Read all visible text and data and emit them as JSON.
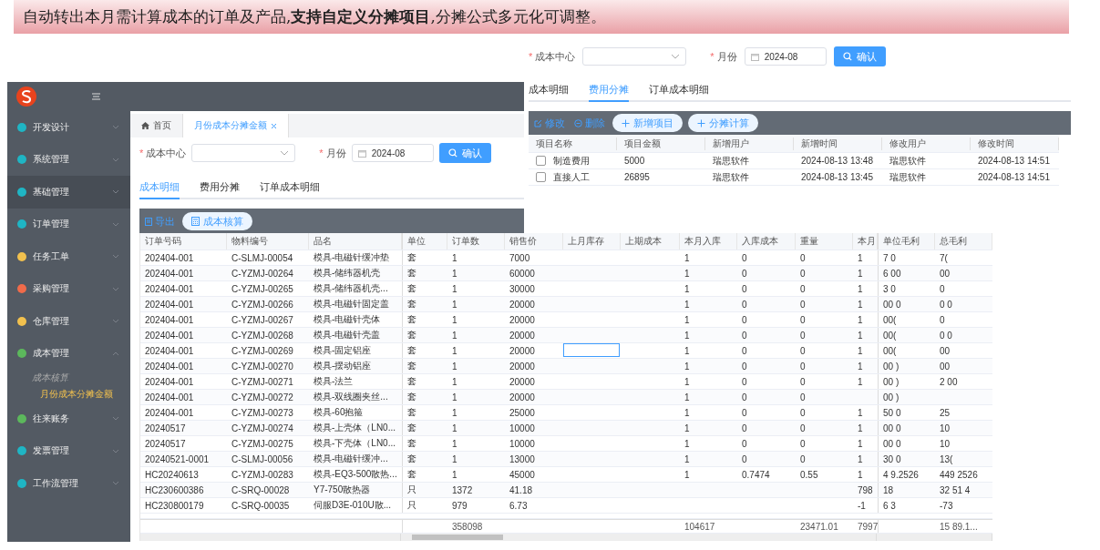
{
  "banner": {
    "text": "自动转出本月需计算成本的订单及产品,**支持自定义分摊项目**,分摊公式多元化可调整。"
  },
  "allocation_panel": {
    "form": {
      "required_mark": "*",
      "cost_center_label": "成本中心",
      "month_label": "月份",
      "month_value": "2024-08",
      "confirm": "确认"
    },
    "tabs": [
      {
        "label": "成本明细",
        "selected": false
      },
      {
        "label": "费用分摊",
        "selected": true
      },
      {
        "label": "订单成本明细",
        "selected": false
      }
    ],
    "toolbar": {
      "edit": "修改",
      "delete": "删除",
      "add": "新增项目",
      "calculate": "分摊计算"
    },
    "table": {
      "columns": [
        "项目名称",
        "项目金额",
        "新增用户",
        "新增时间",
        "修改用户",
        "修改时间"
      ],
      "rows": [
        {
          "checked": false,
          "cells": [
            "制造费用",
            "5000",
            "瑞思软件",
            "2024-08-13 13:48",
            "瑞思软件",
            "2024-08-13 14:51"
          ]
        },
        {
          "checked": false,
          "cells": [
            "直接人工",
            "26895",
            "瑞思软件",
            "2024-08-13 13:45",
            "瑞思软件",
            "2024-08-13 14:51"
          ]
        }
      ]
    }
  },
  "app": {
    "sidebar": {
      "items": [
        {
          "label": "开发设计",
          "color": "#1fb5c4",
          "selected": false,
          "expanded": false
        },
        {
          "label": "系统管理",
          "color": "#1fb5c4",
          "selected": false,
          "expanded": false
        },
        {
          "label": "基础管理",
          "color": "#1fb5c4",
          "selected": true,
          "expanded": false
        },
        {
          "label": "订单管理",
          "color": "#1fb5c4",
          "selected": false,
          "expanded": false
        },
        {
          "label": "任务工单",
          "color": "#f2c14e",
          "selected": false,
          "expanded": false
        },
        {
          "label": "采购管理",
          "color": "#f06b4a",
          "selected": false,
          "expanded": false
        },
        {
          "label": "仓库管理",
          "color": "#f2c14e",
          "selected": false,
          "expanded": false
        },
        {
          "label": "成本管理",
          "color": "#5cb85c",
          "selected": false,
          "expanded": true,
          "children": [
            {
              "label": "成本核算",
              "selected": false
            },
            {
              "label": "月份成本分摊金额",
              "selected": true
            }
          ]
        },
        {
          "label": "往来账务",
          "color": "#5cb85c",
          "selected": false,
          "expanded": false
        },
        {
          "label": "发票管理",
          "color": "#1fb5c4",
          "selected": false,
          "expanded": false
        },
        {
          "label": "工作流管理",
          "color": "#1fb5c4",
          "selected": false,
          "expanded": false
        }
      ]
    },
    "page_tabs": [
      {
        "label": "首页",
        "kind": "home",
        "selected": false
      },
      {
        "label": "月份成本分摊金额",
        "kind": "closable",
        "selected": true
      }
    ],
    "form": {
      "required_mark": "*",
      "cost_center_label": "成本中心",
      "month_label": "月份",
      "month_value": "2024-08",
      "confirm": "确认"
    },
    "tabs": [
      {
        "label": "成本明细",
        "selected": true
      },
      {
        "label": "费用分摊",
        "selected": false
      },
      {
        "label": "订单成本明细",
        "selected": false
      }
    ],
    "toolbar": {
      "export": "导出",
      "calculate": "成本核算"
    },
    "table": {
      "columns": [
        "订单号码",
        "物料编号",
        "品名",
        "单位",
        "订单数",
        "销售价",
        "上月库存",
        "上期成本",
        "本月入库",
        "入库成本",
        "重量",
        "本月",
        "单位毛利",
        "总毛利"
      ],
      "rows": [
        {
          "focused": false,
          "cells": [
            "202404-001",
            "C-SLMJ-00054",
            "模具-电磁针缓冲垫",
            "套",
            "1",
            "7000",
            null,
            null,
            "1",
            "0",
            "0",
            "1",
            "7 0",
            "7("
          ]
        },
        {
          "focused": false,
          "cells": [
            "202404-001",
            "C-YZMJ-00264",
            "模具-储纬器机壳",
            "套",
            "1",
            "60000",
            null,
            null,
            "1",
            "0",
            "0",
            "1",
            "6 00",
            "00"
          ]
        },
        {
          "focused": false,
          "cells": [
            "202404-001",
            "C-YZMJ-00265",
            "模具-储纬器机壳...",
            "套",
            "1",
            "30000",
            null,
            null,
            "1",
            "0",
            "0",
            "1",
            "3 0",
            "0"
          ]
        },
        {
          "focused": false,
          "cells": [
            "202404-001",
            "C-YZMJ-00266",
            "模具-电磁针固定盖",
            "套",
            "1",
            "20000",
            null,
            null,
            "1",
            "0",
            "0",
            "1",
            "00 0",
            "0 0"
          ]
        },
        {
          "focused": false,
          "cells": [
            "202404-001",
            "C-YZMJ-00267",
            "模具-电磁针壳体",
            "套",
            "1",
            "20000",
            null,
            null,
            "1",
            "0",
            "0",
            "1",
            "00(",
            "0"
          ]
        },
        {
          "focused": false,
          "cells": [
            "202404-001",
            "C-YZMJ-00268",
            "模具-电磁针壳盖",
            "套",
            "1",
            "20000",
            null,
            null,
            "1",
            "0",
            "0",
            "1",
            "00(",
            "0 0"
          ]
        },
        {
          "focused": true,
          "cells": [
            "202404-001",
            "C-YZMJ-00269",
            "模具-固定铝座",
            "套",
            "1",
            "20000",
            null,
            null,
            "1",
            "0",
            "0",
            "1",
            "00(",
            "00"
          ]
        },
        {
          "focused": false,
          "cells": [
            "202404-001",
            "C-YZMJ-00270",
            "模具-摆动铝座",
            "套",
            "1",
            "20000",
            null,
            null,
            "1",
            "0",
            "0",
            "1",
            "00 )",
            "00"
          ]
        },
        {
          "focused": false,
          "cells": [
            "202404-001",
            "C-YZMJ-00271",
            "模具-法兰",
            "套",
            "1",
            "20000",
            null,
            null,
            "1",
            "0",
            "0",
            "1",
            "00 )",
            "2 00"
          ]
        },
        {
          "focused": false,
          "cells": [
            "202404-001",
            "C-YZMJ-00272",
            "模具-双线圈夹丝...",
            "套",
            "1",
            "20000",
            null,
            null,
            "1",
            "0",
            "0",
            null,
            "00 )",
            null
          ]
        },
        {
          "focused": false,
          "cells": [
            "202404-001",
            "C-YZMJ-00273",
            "模具-60抱箍",
            "套",
            "1",
            "25000",
            null,
            null,
            "1",
            "0",
            "0",
            "1",
            "50 0",
            "25"
          ]
        },
        {
          "focused": false,
          "cells": [
            "20240517",
            "C-YZMJ-00274",
            "模具-上壳体（LN0...",
            "套",
            "1",
            "10000",
            null,
            null,
            "1",
            "0",
            "0",
            "1",
            "00 0",
            "10"
          ]
        },
        {
          "focused": false,
          "cells": [
            "20240517",
            "C-YZMJ-00275",
            "模具-下壳体（LN0...",
            "套",
            "1",
            "10000",
            null,
            null,
            "1",
            "0",
            "0",
            "1",
            "00 0",
            "10"
          ]
        },
        {
          "focused": false,
          "cells": [
            "20240521-0001",
            "C-SLMJ-00056",
            "模具-电磁针缓冲...",
            "套",
            "1",
            "13000",
            null,
            null,
            "1",
            "0",
            "0",
            "1",
            "30 0",
            "13("
          ]
        },
        {
          "focused": false,
          "cells": [
            "HC20240613",
            "C-YZMJ-00283",
            "模具-EQ3-500散热...",
            "套",
            "1",
            "45000",
            null,
            null,
            "1",
            "0.7474",
            "0.55",
            "1",
            "4 9.2526",
            "449 2526"
          ]
        },
        {
          "focused": false,
          "cells": [
            "HC230600386",
            "C-SRQ-00028",
            "Y7-750散热器",
            "只",
            "1372",
            "41.18",
            null,
            null,
            null,
            null,
            null,
            "798",
            "18",
            "32 51 4"
          ]
        },
        {
          "focused": false,
          "cells": [
            "HC230800179",
            "C-SRQ-00035",
            "伺服D3E-010U散...",
            "只",
            "979",
            "6.73",
            null,
            null,
            null,
            null,
            null,
            "-1",
            "6 3",
            "-73"
          ]
        }
      ],
      "totals": {
        "order_count": "358098",
        "month_in": "104617",
        "weight": "23471.01",
        "month_out": "7997",
        "total_profit": "15 89.1..."
      }
    }
  }
}
